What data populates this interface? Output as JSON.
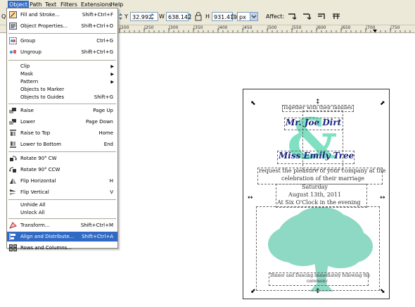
{
  "menubar": {
    "items": [
      {
        "label": "Object"
      },
      {
        "label": "Path"
      },
      {
        "label": "Text"
      },
      {
        "label": "Filters"
      },
      {
        "label": "Extensions"
      },
      {
        "label": "Help"
      }
    ]
  },
  "toolbar": {
    "y_label": "Y",
    "y_value": "32.992",
    "w_label": "W",
    "w_value": "638.142",
    "h_label": "H",
    "h_value": "931.419",
    "unit": "px",
    "affect_label": "Affect:"
  },
  "ruler": {
    "labels": [
      "|200",
      "|250",
      "|300",
      "|350",
      "|400",
      "|450",
      "|500",
      "|550",
      "|600",
      "|650",
      "|700",
      "|750"
    ]
  },
  "object_menu": {
    "items": [
      {
        "label": "Fill and Stroke...",
        "shortcut": "Shift+Ctrl+F",
        "icon": "fill-stroke-icon"
      },
      {
        "label": "Object Properties...",
        "shortcut": "Shift+Ctrl+O",
        "icon": "object-properties-icon"
      },
      {
        "label": "Group",
        "shortcut": "Ctrl+G",
        "icon": "group-icon"
      },
      {
        "label": "Ungroup",
        "shortcut": "Shift+Ctrl+G",
        "icon": "ungroup-icon"
      },
      {
        "label": "Clip",
        "shortcut": ""
      },
      {
        "label": "Mask",
        "shortcut": ""
      },
      {
        "label": "Pattern",
        "shortcut": ""
      },
      {
        "label": "Objects to Marker",
        "shortcut": ""
      },
      {
        "label": "Objects to Guides",
        "shortcut": "Shift+G"
      },
      {
        "label": "Raise",
        "shortcut": "Page Up",
        "icon": "raise-icon"
      },
      {
        "label": "Lower",
        "shortcut": "Page Down",
        "icon": "lower-icon"
      },
      {
        "label": "Raise to Top",
        "shortcut": "Home",
        "icon": "raise-to-top-icon"
      },
      {
        "label": "Lower to Bottom",
        "shortcut": "End",
        "icon": "lower-to-bottom-icon"
      },
      {
        "label": "Rotate 90° CW",
        "shortcut": "",
        "icon": "rotate-cw-icon"
      },
      {
        "label": "Rotate 90° CCW",
        "shortcut": "",
        "icon": "rotate-ccw-icon"
      },
      {
        "label": "Flip Horizontal",
        "shortcut": "H",
        "icon": "flip-horizontal-icon"
      },
      {
        "label": "Flip Vertical",
        "shortcut": "V",
        "icon": "flip-vertical-icon"
      },
      {
        "label": "Unhide All",
        "shortcut": ""
      },
      {
        "label": "Unlock All",
        "shortcut": ""
      },
      {
        "label": "Transform...",
        "shortcut": "Shift+Ctrl+M",
        "icon": "transform-icon"
      },
      {
        "label": "Align and Distribute...",
        "shortcut": "Shift+Ctrl+A",
        "icon": "align-distribute-icon"
      },
      {
        "label": "Rows and Columns...",
        "shortcut": "",
        "icon": "rows-columns-icon"
      }
    ]
  },
  "invitation": {
    "line1": "Together with their families",
    "name1": "Mr. Joe Dirt",
    "ampersand": "&",
    "name2": "Miss Emily Tree",
    "request1": "request the pleasure of your company at the",
    "request2": "celebration of their marriage",
    "day": "Saturday",
    "date": "August 13th, 2011",
    "time": "At Six O'Clock in the evening",
    "footer1": "Dinner and Dancing immediately following the",
    "footer2": "ceremony"
  },
  "colors": {
    "accent": "#316ac5",
    "name_blue": "#1a237e",
    "mint": "#7fe0c2",
    "tree": "#8ed9c4"
  }
}
